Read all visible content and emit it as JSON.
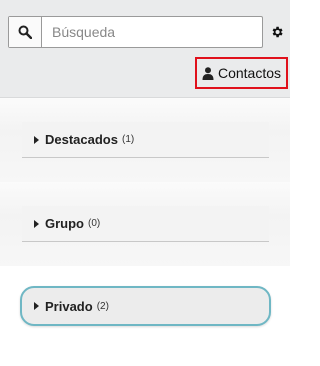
{
  "search": {
    "placeholder": "Búsqueda"
  },
  "header": {
    "contacts_label": "Contactos"
  },
  "groups": [
    {
      "name": "Destacados",
      "count": "(1)"
    },
    {
      "name": "Grupo",
      "count": "(0)"
    },
    {
      "name": "Privado",
      "count": "(2)"
    }
  ],
  "colors": {
    "highlight_border": "#e0101b",
    "active_outline": "#6fb7c4"
  }
}
